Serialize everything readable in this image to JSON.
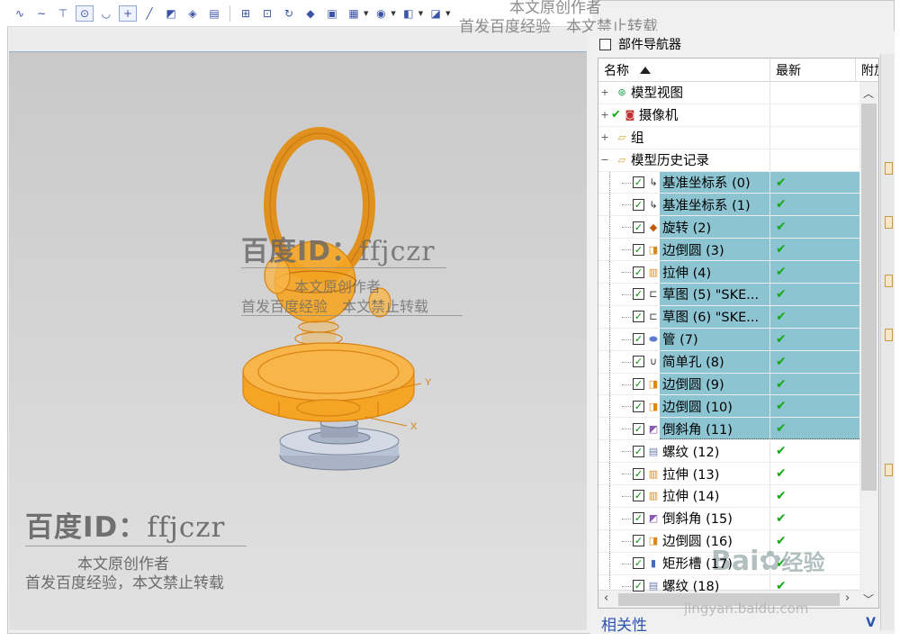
{
  "toolbar": {
    "buttons": [
      "sketch-curve-icon",
      "spline-icon",
      "line-icon",
      "point-icon",
      "arc-icon",
      "plus-icon",
      "line-tool-icon",
      "feature-icon",
      "sheet-icon",
      "shade-icon",
      "section-icon",
      "view-icon",
      "rotate-icon",
      "paint-icon",
      "render-icon",
      "layer-icon",
      "display-icon",
      "orient-icon",
      "box-icon"
    ]
  },
  "navigator": {
    "title": "部件导航器",
    "columns": {
      "name": "名称",
      "latest": "最新",
      "attached": "附加"
    },
    "items": [
      {
        "label": "模型视图",
        "icon": "model-views-icon",
        "level": 0,
        "expander": "+",
        "checkbox": "",
        "check": "",
        "selected": false
      },
      {
        "label": "摄像机",
        "icon": "camera-icon",
        "level": 0,
        "expander": "+",
        "checkbox": "",
        "check": "",
        "selected": false
      },
      {
        "label": "组",
        "icon": "folder-icon",
        "level": 0,
        "expander": "+",
        "checkbox": "",
        "check": "",
        "selected": false
      },
      {
        "label": "模型历史记录",
        "icon": "folder-open-icon",
        "level": 0,
        "expander": "−",
        "checkbox": "",
        "check": "",
        "selected": false
      },
      {
        "label": "基准坐标系 (0)",
        "icon": "datum-csys-icon",
        "level": 1,
        "expander": "",
        "checkbox": "✓",
        "check": "✔",
        "selected": true
      },
      {
        "label": "基准坐标系 (1)",
        "icon": "datum-csys-icon",
        "level": 1,
        "expander": "",
        "checkbox": "✓",
        "check": "✔",
        "selected": true
      },
      {
        "label": "旋转 (2)",
        "icon": "revolve-icon",
        "level": 1,
        "expander": "",
        "checkbox": "✓",
        "check": "✔",
        "selected": true
      },
      {
        "label": "边倒圆 (3)",
        "icon": "edge-blend-icon",
        "level": 1,
        "expander": "",
        "checkbox": "✓",
        "check": "✔",
        "selected": true
      },
      {
        "label": "拉伸 (4)",
        "icon": "extrude-icon",
        "level": 1,
        "expander": "",
        "checkbox": "✓",
        "check": "✔",
        "selected": true
      },
      {
        "label": "草图 (5) \"SKE...",
        "icon": "sketch-icon",
        "level": 1,
        "expander": "",
        "checkbox": "✓",
        "check": "✔",
        "selected": true
      },
      {
        "label": "草图 (6) \"SKE...",
        "icon": "sketch-icon",
        "level": 1,
        "expander": "",
        "checkbox": "✓",
        "check": "✔",
        "selected": true
      },
      {
        "label": "管 (7)",
        "icon": "tube-icon",
        "level": 1,
        "expander": "",
        "checkbox": "✓",
        "check": "✔",
        "selected": true
      },
      {
        "label": "简单孔 (8)",
        "icon": "hole-icon",
        "level": 1,
        "expander": "",
        "checkbox": "✓",
        "check": "✔",
        "selected": true
      },
      {
        "label": "边倒圆 (9)",
        "icon": "edge-blend-icon",
        "level": 1,
        "expander": "",
        "checkbox": "✓",
        "check": "✔",
        "selected": true
      },
      {
        "label": "边倒圆 (10)",
        "icon": "edge-blend-icon",
        "level": 1,
        "expander": "",
        "checkbox": "✓",
        "check": "✔",
        "selected": true
      },
      {
        "label": "倒斜角 (11)",
        "icon": "chamfer-icon",
        "level": 1,
        "expander": "",
        "checkbox": "✓",
        "check": "✔",
        "selected": true
      },
      {
        "label": "螺纹 (12)",
        "icon": "thread-icon",
        "level": 1,
        "expander": "",
        "checkbox": "✓",
        "check": "✔",
        "selected": false
      },
      {
        "label": "拉伸 (13)",
        "icon": "extrude-icon",
        "level": 1,
        "expander": "",
        "checkbox": "✓",
        "check": "✔",
        "selected": false
      },
      {
        "label": "拉伸 (14)",
        "icon": "extrude-icon",
        "level": 1,
        "expander": "",
        "checkbox": "✓",
        "check": "✔",
        "selected": false
      },
      {
        "label": "倒斜角 (15)",
        "icon": "chamfer-icon",
        "level": 1,
        "expander": "",
        "checkbox": "✓",
        "check": "✔",
        "selected": false
      },
      {
        "label": "边倒圆 (16)",
        "icon": "edge-blend-icon",
        "level": 1,
        "expander": "",
        "checkbox": "✓",
        "check": "✔",
        "selected": false
      },
      {
        "label": "矩形槽 (17)",
        "icon": "groove-icon",
        "level": 1,
        "expander": "",
        "checkbox": "✓",
        "check": "✔",
        "selected": false
      },
      {
        "label": "螺纹 (18)",
        "icon": "thread-icon",
        "level": 1,
        "expander": "",
        "checkbox": "✓",
        "check": "✔",
        "selected": false
      }
    ],
    "related_label": "相关性"
  },
  "viewport": {
    "axis_x": "X",
    "axis_y": "Y",
    "model_color": "#f5a523",
    "base_color": "#b9c3d6"
  },
  "watermarks": {
    "top_line1": "本文原创作者",
    "top_line2": "首发百度经验　本文禁止转载",
    "center_id": "百度ID：",
    "center_handle": "ffjczr",
    "center_line1": "本文原创作者",
    "center_line2": "首发百度经验　本文禁止转载",
    "corner_id": "百度ID：",
    "corner_handle": "ffjczr",
    "corner_line1": "本文原创作者",
    "corner_line2": "首发百度经验，本文禁止转载",
    "baidu_logo": "Bai",
    "baidu_logo_tail": "经验",
    "baidu_url": "jingyan.baidu.com"
  },
  "colors": {
    "selection": "#8cc4d2",
    "accent_blue": "#2b54b0",
    "check_green": "#18a818"
  }
}
